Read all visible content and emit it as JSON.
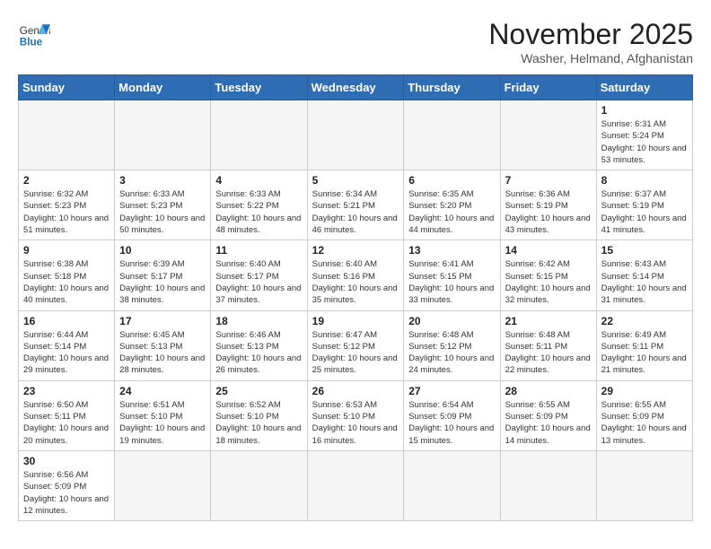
{
  "logo": {
    "line1": "General",
    "line2": "Blue"
  },
  "title": "November 2025",
  "location": "Washer, Helmand, Afghanistan",
  "days_of_week": [
    "Sunday",
    "Monday",
    "Tuesday",
    "Wednesday",
    "Thursday",
    "Friday",
    "Saturday"
  ],
  "weeks": [
    [
      {
        "day": "",
        "info": ""
      },
      {
        "day": "",
        "info": ""
      },
      {
        "day": "",
        "info": ""
      },
      {
        "day": "",
        "info": ""
      },
      {
        "day": "",
        "info": ""
      },
      {
        "day": "",
        "info": ""
      },
      {
        "day": "1",
        "info": "Sunrise: 6:31 AM\nSunset: 5:24 PM\nDaylight: 10 hours and 53 minutes."
      }
    ],
    [
      {
        "day": "2",
        "info": "Sunrise: 6:32 AM\nSunset: 5:23 PM\nDaylight: 10 hours and 51 minutes."
      },
      {
        "day": "3",
        "info": "Sunrise: 6:33 AM\nSunset: 5:23 PM\nDaylight: 10 hours and 50 minutes."
      },
      {
        "day": "4",
        "info": "Sunrise: 6:33 AM\nSunset: 5:22 PM\nDaylight: 10 hours and 48 minutes."
      },
      {
        "day": "5",
        "info": "Sunrise: 6:34 AM\nSunset: 5:21 PM\nDaylight: 10 hours and 46 minutes."
      },
      {
        "day": "6",
        "info": "Sunrise: 6:35 AM\nSunset: 5:20 PM\nDaylight: 10 hours and 44 minutes."
      },
      {
        "day": "7",
        "info": "Sunrise: 6:36 AM\nSunset: 5:19 PM\nDaylight: 10 hours and 43 minutes."
      },
      {
        "day": "8",
        "info": "Sunrise: 6:37 AM\nSunset: 5:19 PM\nDaylight: 10 hours and 41 minutes."
      }
    ],
    [
      {
        "day": "9",
        "info": "Sunrise: 6:38 AM\nSunset: 5:18 PM\nDaylight: 10 hours and 40 minutes."
      },
      {
        "day": "10",
        "info": "Sunrise: 6:39 AM\nSunset: 5:17 PM\nDaylight: 10 hours and 38 minutes."
      },
      {
        "day": "11",
        "info": "Sunrise: 6:40 AM\nSunset: 5:17 PM\nDaylight: 10 hours and 37 minutes."
      },
      {
        "day": "12",
        "info": "Sunrise: 6:40 AM\nSunset: 5:16 PM\nDaylight: 10 hours and 35 minutes."
      },
      {
        "day": "13",
        "info": "Sunrise: 6:41 AM\nSunset: 5:15 PM\nDaylight: 10 hours and 33 minutes."
      },
      {
        "day": "14",
        "info": "Sunrise: 6:42 AM\nSunset: 5:15 PM\nDaylight: 10 hours and 32 minutes."
      },
      {
        "day": "15",
        "info": "Sunrise: 6:43 AM\nSunset: 5:14 PM\nDaylight: 10 hours and 31 minutes."
      }
    ],
    [
      {
        "day": "16",
        "info": "Sunrise: 6:44 AM\nSunset: 5:14 PM\nDaylight: 10 hours and 29 minutes."
      },
      {
        "day": "17",
        "info": "Sunrise: 6:45 AM\nSunset: 5:13 PM\nDaylight: 10 hours and 28 minutes."
      },
      {
        "day": "18",
        "info": "Sunrise: 6:46 AM\nSunset: 5:13 PM\nDaylight: 10 hours and 26 minutes."
      },
      {
        "day": "19",
        "info": "Sunrise: 6:47 AM\nSunset: 5:12 PM\nDaylight: 10 hours and 25 minutes."
      },
      {
        "day": "20",
        "info": "Sunrise: 6:48 AM\nSunset: 5:12 PM\nDaylight: 10 hours and 24 minutes."
      },
      {
        "day": "21",
        "info": "Sunrise: 6:48 AM\nSunset: 5:11 PM\nDaylight: 10 hours and 22 minutes."
      },
      {
        "day": "22",
        "info": "Sunrise: 6:49 AM\nSunset: 5:11 PM\nDaylight: 10 hours and 21 minutes."
      }
    ],
    [
      {
        "day": "23",
        "info": "Sunrise: 6:50 AM\nSunset: 5:11 PM\nDaylight: 10 hours and 20 minutes."
      },
      {
        "day": "24",
        "info": "Sunrise: 6:51 AM\nSunset: 5:10 PM\nDaylight: 10 hours and 19 minutes."
      },
      {
        "day": "25",
        "info": "Sunrise: 6:52 AM\nSunset: 5:10 PM\nDaylight: 10 hours and 18 minutes."
      },
      {
        "day": "26",
        "info": "Sunrise: 6:53 AM\nSunset: 5:10 PM\nDaylight: 10 hours and 16 minutes."
      },
      {
        "day": "27",
        "info": "Sunrise: 6:54 AM\nSunset: 5:09 PM\nDaylight: 10 hours and 15 minutes."
      },
      {
        "day": "28",
        "info": "Sunrise: 6:55 AM\nSunset: 5:09 PM\nDaylight: 10 hours and 14 minutes."
      },
      {
        "day": "29",
        "info": "Sunrise: 6:55 AM\nSunset: 5:09 PM\nDaylight: 10 hours and 13 minutes."
      }
    ],
    [
      {
        "day": "30",
        "info": "Sunrise: 6:56 AM\nSunset: 5:09 PM\nDaylight: 10 hours and 12 minutes."
      },
      {
        "day": "",
        "info": ""
      },
      {
        "day": "",
        "info": ""
      },
      {
        "day": "",
        "info": ""
      },
      {
        "day": "",
        "info": ""
      },
      {
        "day": "",
        "info": ""
      },
      {
        "day": "",
        "info": ""
      }
    ]
  ]
}
